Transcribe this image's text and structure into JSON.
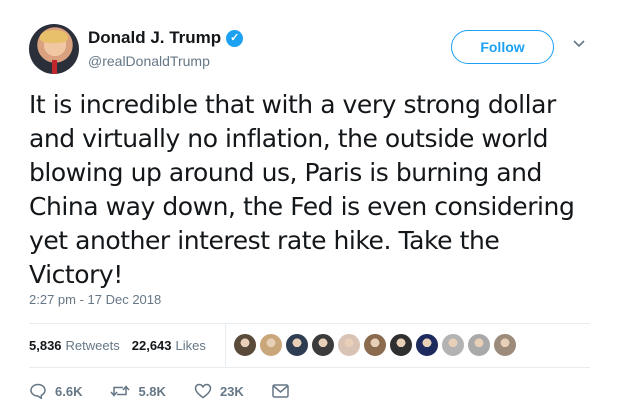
{
  "user": {
    "name": "Donald J. Trump",
    "handle": "@realDonaldTrump",
    "verified_icon": "verified-badge-icon"
  },
  "follow_label": "Follow",
  "tweet": {
    "text_lines": [
      "It is incredible that with a very strong dollar",
      "and virtually no inflation, the outside world",
      "blowing up around us, Paris is burning and",
      "China way down, the Fed is even considering",
      "yet another interest rate hike. Take the",
      "Victory!"
    ],
    "timestamp": "2:27 pm - 17 Dec 2018"
  },
  "stats": {
    "retweets_count": "5,836",
    "retweets_label": "Retweets",
    "likes_count": "22,643",
    "likes_label": "Likes"
  },
  "liker_avatars": [
    "#5a4a3a",
    "#c9a77a",
    "#2e3d52",
    "#3b3b3b",
    "#d8c3b5",
    "#8b6b4e",
    "#2f2f2f",
    "#1c2a5e",
    "#b3b3b3",
    "#a9a9a9",
    "#9c8a7a"
  ],
  "actions": {
    "reply_count": "6.6K",
    "retweet_count": "5.8K",
    "like_count": "23K"
  },
  "colors": {
    "accent": "#1da1f2",
    "muted": "#657786",
    "text": "#14171a"
  }
}
